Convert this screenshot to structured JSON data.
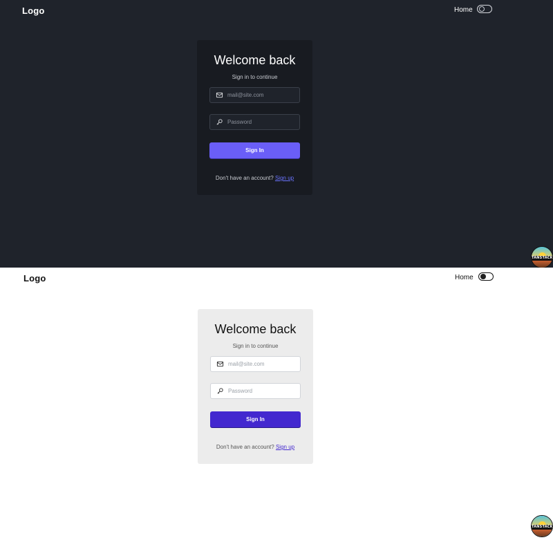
{
  "dark": {
    "header": {
      "logo": "Logo",
      "nav_home": "Home"
    },
    "card": {
      "title": "Welcome back",
      "subtitle": "Sign in to continue",
      "email_placeholder": "mail@site.com",
      "password_placeholder": "Password",
      "signin_label": "Sign In",
      "footer_text": "Don't have an account?",
      "signup_link": "Sign up"
    },
    "devtools_label": "TANSTACK"
  },
  "light": {
    "header": {
      "logo": "Logo",
      "nav_home": "Home"
    },
    "card": {
      "title": "Welcome back",
      "subtitle": "Sign in to continue",
      "email_placeholder": "mail@site.com",
      "password_placeholder": "Password",
      "signin_label": "Sign In",
      "footer_text": "Don't have an account?",
      "signup_link": "Sign up"
    },
    "devtools_label": "TANSTACK"
  },
  "theme": {
    "dark_bg": "#1f232b",
    "dark_card": "#181b21",
    "dark_accent": "#6a5ef7",
    "light_bg": "#ffffff",
    "light_card": "#ececec",
    "light_accent": "#4328cf"
  },
  "icons": [
    "mail-icon",
    "key-icon",
    "theme-toggle",
    "tanstack-devtools-logo"
  ]
}
